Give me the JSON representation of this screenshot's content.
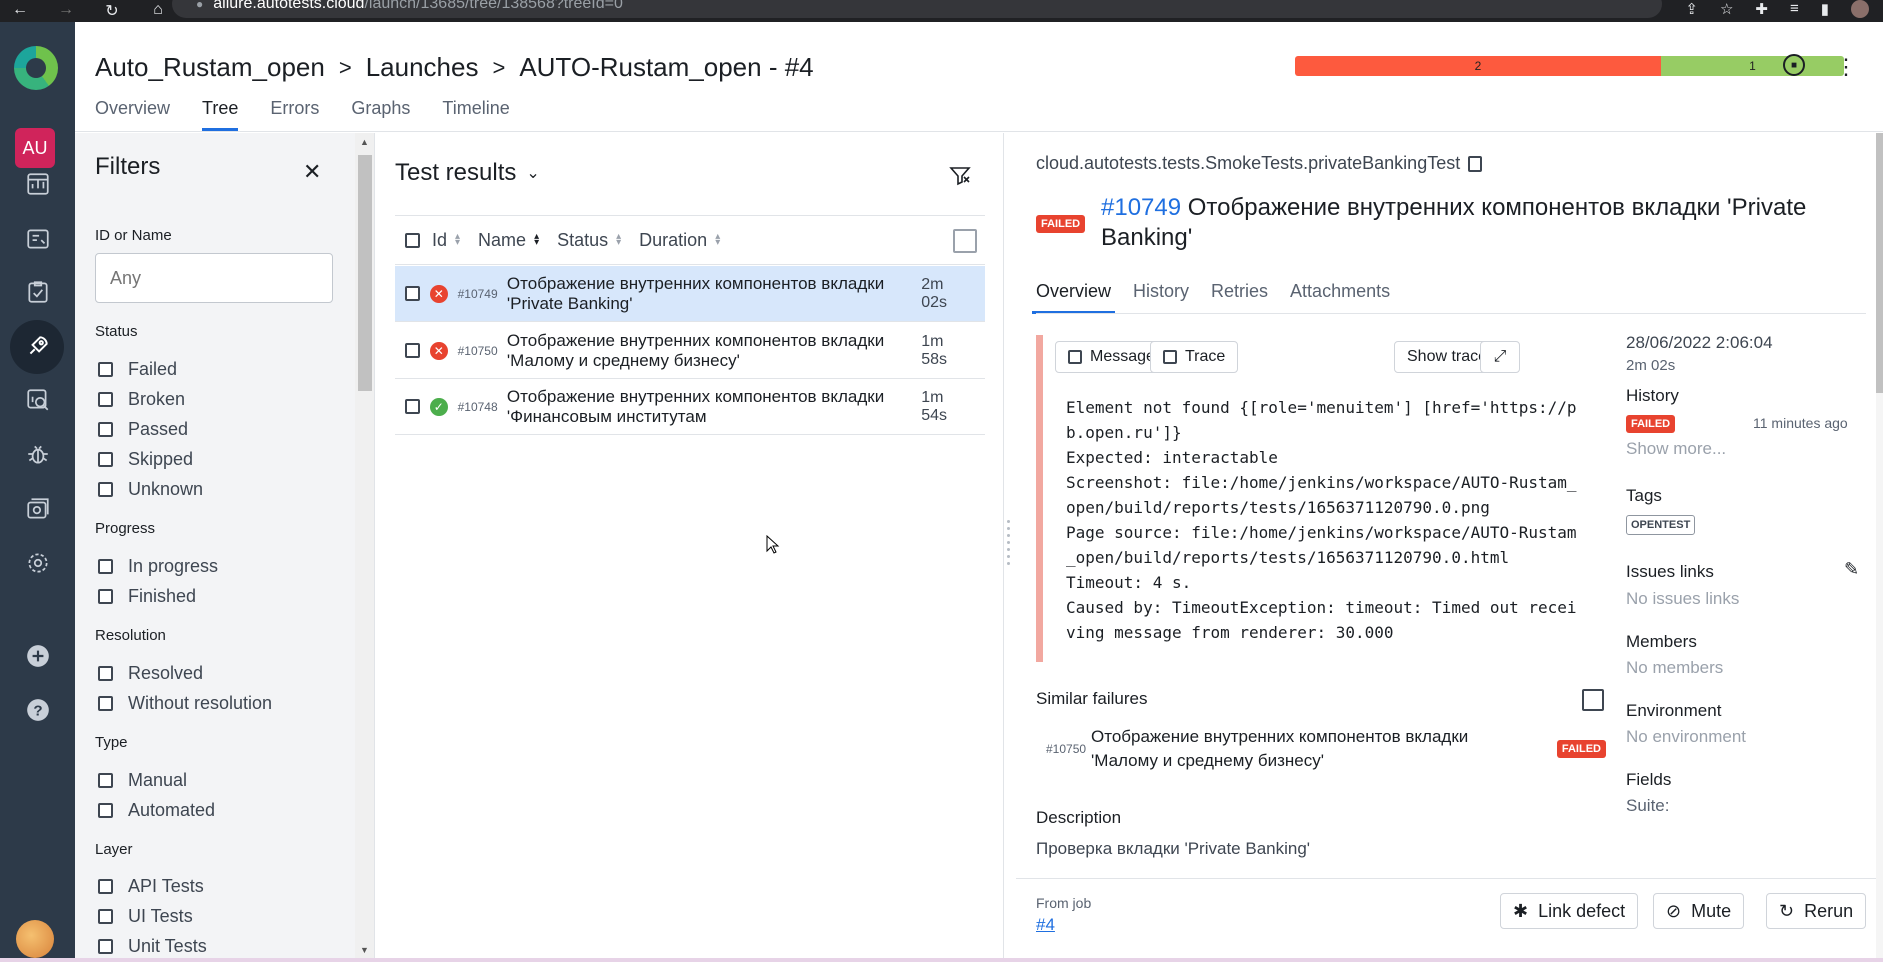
{
  "browser": {
    "url_host": "allure.autotests.cloud",
    "url_path": "/launch/13685/tree/138568?treeId=0"
  },
  "sidebar": {
    "project_badge": "AU"
  },
  "header": {
    "breadcrumbs": [
      "Auto_Rustam_open",
      "Launches",
      "AUTO-Rustam_open - #4"
    ],
    "tabs": [
      "Overview",
      "Tree",
      "Errors",
      "Graphs",
      "Timeline"
    ],
    "active_tab": "Tree",
    "stats": [
      {
        "label": "2",
        "value": 2,
        "color": "#fd5a3e"
      },
      {
        "label": "1",
        "value": 1,
        "color": "#97cc64"
      }
    ]
  },
  "filters": {
    "title": "Filters",
    "id_label": "ID or Name",
    "id_placeholder": "Any",
    "groups": [
      {
        "label": "Status",
        "options": [
          "Failed",
          "Broken",
          "Passed",
          "Skipped",
          "Unknown"
        ]
      },
      {
        "label": "Progress",
        "options": [
          "In progress",
          "Finished"
        ]
      },
      {
        "label": "Resolution",
        "options": [
          "Resolved",
          "Without resolution"
        ]
      },
      {
        "label": "Type",
        "options": [
          "Manual",
          "Automated"
        ]
      },
      {
        "label": "Layer",
        "options": [
          "API Tests",
          "UI Tests",
          "Unit Tests"
        ]
      }
    ]
  },
  "results": {
    "title": "Test results",
    "columns": [
      "Id",
      "Name",
      "Status",
      "Duration"
    ],
    "rows": [
      {
        "id": "#10749",
        "name": "Отображение внутренних компонентов вкладки 'Private Banking'",
        "status": "failed",
        "duration": "2m 02s",
        "selected": true
      },
      {
        "id": "#10750",
        "name": "Отображение внутренних компонентов вкладки 'Малому и среднему бизнесу'",
        "status": "failed",
        "duration": "1m 58s",
        "selected": false
      },
      {
        "id": "#10748",
        "name": "Отображение внутренних компонентов вкладки 'Финансовым институтам",
        "status": "passed",
        "duration": "1m 54s",
        "selected": false
      }
    ]
  },
  "details": {
    "full_name": "cloud.autotests.tests.SmokeTests.privateBankingTest",
    "status_badge": "FAILED",
    "test_id": "#10749",
    "test_title": "Отображение внутренних компонентов вкладки 'Private Banking'",
    "tabs": [
      "Overview",
      "History",
      "Retries",
      "Attachments"
    ],
    "message_button": "Message",
    "trace_button": "Trace",
    "show_trace_button": "Show trace",
    "error_text": "Element not found {[role='menuitem'] [href='https://pb.open.ru']}\nExpected: interactable\nScreenshot: file:/home/jenkins/workspace/AUTO-Rustam_open/build/reports/tests/1656371120790.0.png\nPage source: file:/home/jenkins/workspace/AUTO-Rustam_open/build/reports/tests/1656371120790.0.html\nTimeout: 4 s.\nCaused by: TimeoutException: timeout: Timed out receiving message from renderer: 30.000",
    "similar_failures_title": "Similar failures",
    "similar": {
      "id": "#10750",
      "name": "Отображение внутренних компонентов вкладки 'Малому и среднему бизнесу'",
      "badge": "FAILED"
    },
    "description_title": "Description",
    "description_text": "Проверка вкладки 'Private Banking'",
    "side": {
      "date": "28/06/2022 2:06:04",
      "duration": "2m 02s",
      "history_title": "History",
      "history_badge": "FAILED",
      "history_time": "11 minutes ago",
      "show_more": "Show more...",
      "tags_title": "Tags",
      "tag": "OPENTEST",
      "issues_title": "Issues links",
      "issues_empty": "No issues links",
      "members_title": "Members",
      "members_empty": "No members",
      "env_title": "Environment",
      "env_empty": "No environment",
      "fields_title": "Fields",
      "suite_label": "Suite:"
    },
    "footer": {
      "from_job": "From job",
      "job_link": "#4",
      "link_defect": "Link defect",
      "mute": "Mute",
      "rerun": "Rerun"
    }
  }
}
